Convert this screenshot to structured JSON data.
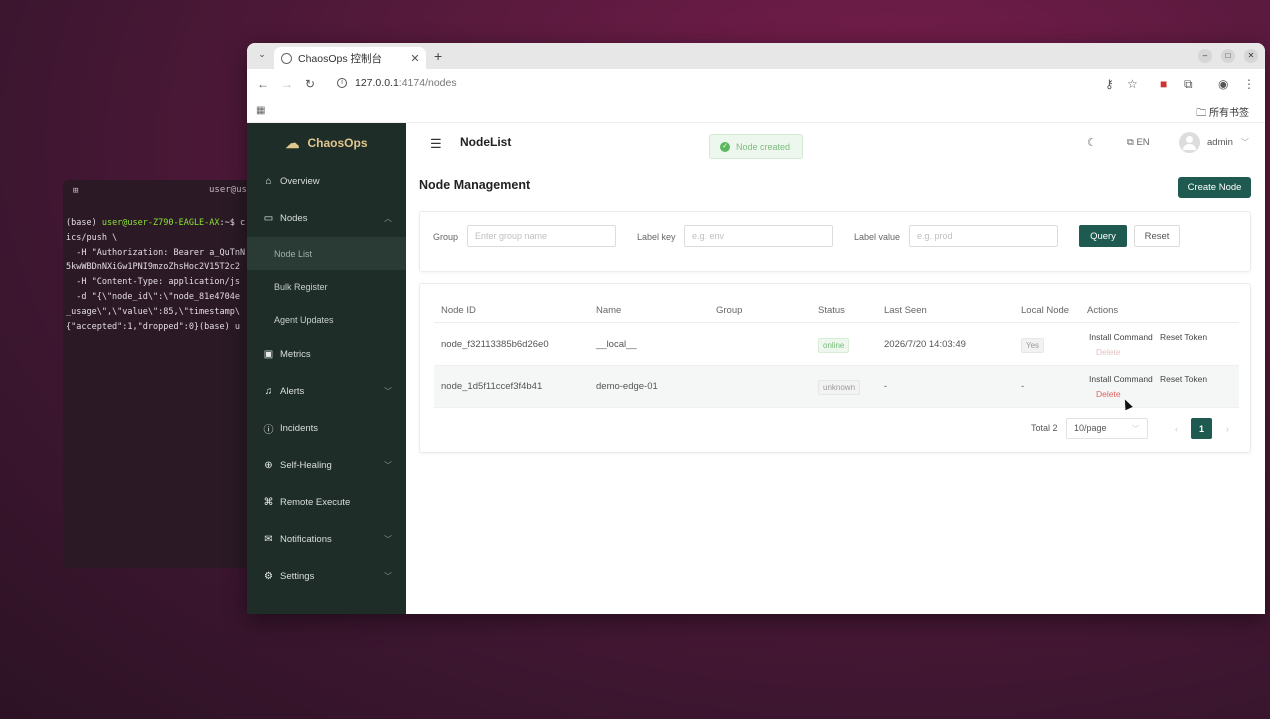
{
  "terminal": {
    "title": "user@us",
    "lines": [
      {
        "prefix": "(base) ",
        "user": "user@user-Z790-EAGLE-AX",
        "rest": ":~$ c"
      },
      {
        "text": "ics/push \\"
      },
      {
        "text": "  -H \"Authorization: Bearer a_QuTnN"
      },
      {
        "text": "5kwWBDnNXiGw1PNI9mzoZhsHoc2V15T2c2"
      },
      {
        "text": "  -H \"Content-Type: application/js"
      },
      {
        "text": "  -d \"{\\\"node_id\\\":\\\"node_81e4704e"
      },
      {
        "text": "_usage\\\",\\\"value\\\":85,\\\"timestamp\\"
      },
      {
        "text": "{\"accepted\":1,\"dropped\":0}(base) u"
      }
    ]
  },
  "browser": {
    "tab_title": "ChaosOps 控制台",
    "address_host": "127.0.0.1",
    "address_path": ":4174/nodes",
    "bookmarks_all": "所有书签"
  },
  "app": {
    "brand": "ChaosOps",
    "nav": {
      "overview": "Overview",
      "nodes": "Nodes",
      "node_list": "Node List",
      "bulk_register": "Bulk Register",
      "agent_updates": "Agent Updates",
      "metrics": "Metrics",
      "alerts": "Alerts",
      "incidents": "Incidents",
      "self_healing": "Self-Healing",
      "remote_execute": "Remote Execute",
      "notifications": "Notifications",
      "settings": "Settings"
    },
    "header": {
      "page_name": "NodeList",
      "toast": "Node created",
      "lang": "EN",
      "user": "admin"
    },
    "title": "Node Management",
    "create_button": "Create Node",
    "filters": {
      "group_label": "Group",
      "group_placeholder": "Enter group name",
      "label_key_label": "Label key",
      "label_key_placeholder": "e.g. env",
      "label_value_label": "Label value",
      "label_value_placeholder": "e.g. prod",
      "query": "Query",
      "reset": "Reset"
    },
    "table": {
      "columns": [
        "Node ID",
        "Name",
        "Group",
        "Status",
        "Last Seen",
        "Local Node",
        "Actions"
      ],
      "rows": [
        {
          "node_id": "node_f32113385b6d26e0",
          "name": "__local__",
          "group": "",
          "status": "online",
          "last_seen": "2026/7/20 14:03:49",
          "local": "Yes"
        },
        {
          "node_id": "node_1d5f11ccef3f4b41",
          "name": "demo-edge-01",
          "group": "",
          "status": "unknown",
          "last_seen": "-",
          "local": "-"
        }
      ],
      "actions": {
        "install": "Install Command",
        "reset_token": "Reset Token",
        "delete": "Delete"
      }
    },
    "pagination": {
      "total": "Total 2",
      "page_size": "10/page",
      "current": "1"
    }
  }
}
